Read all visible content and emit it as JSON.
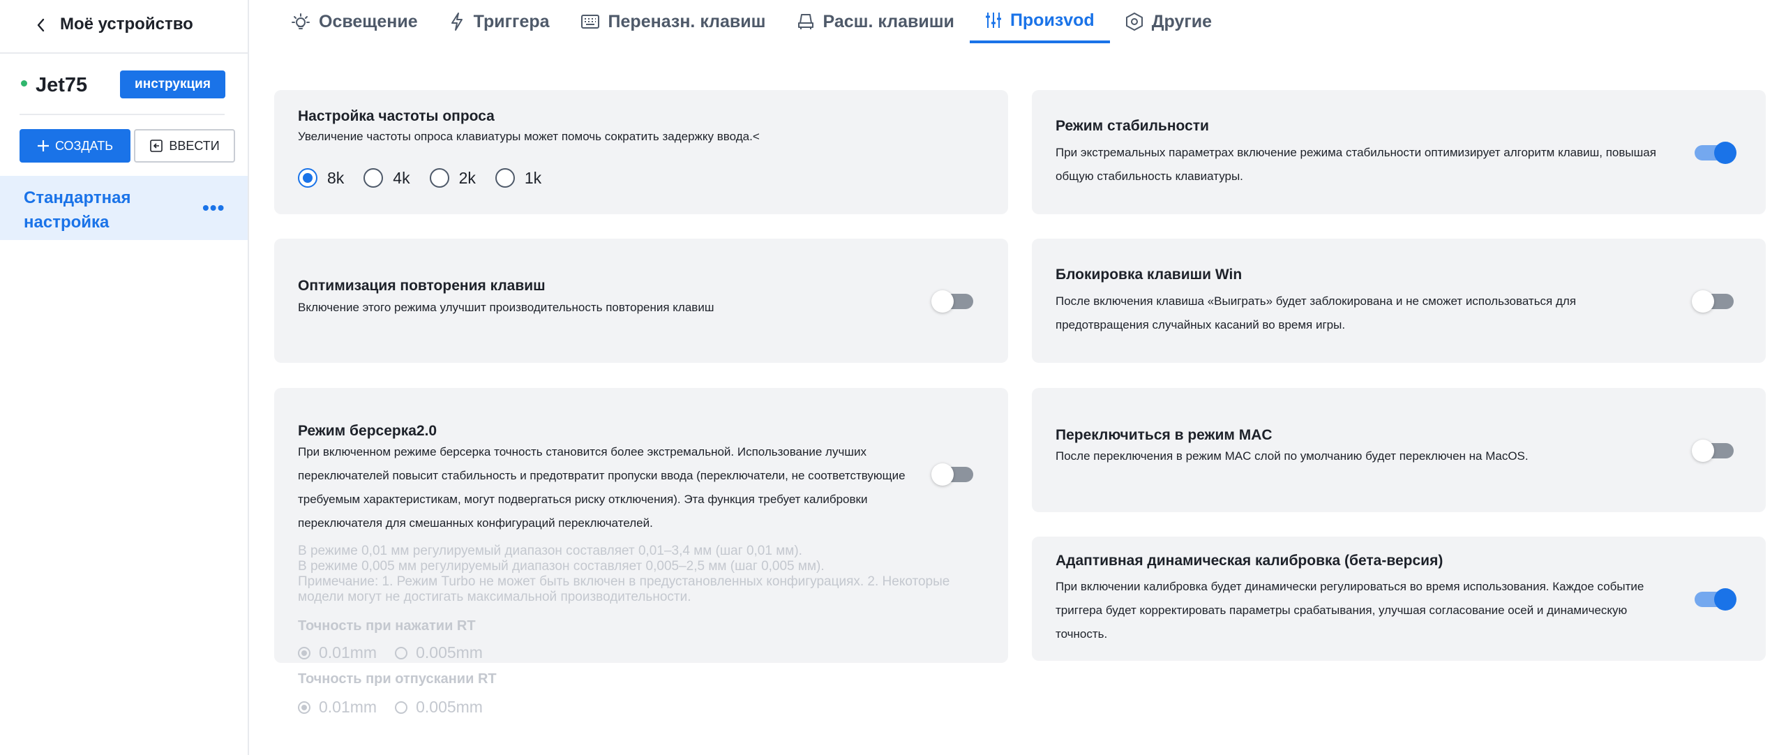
{
  "sidebar": {
    "title": "Моё устройство",
    "device_name": "Jet75",
    "instruction_button": "инструкция",
    "create_button": "СОЗДАТЬ",
    "import_button": "ВВЕСТИ",
    "profile": {
      "name": "Стандартная настройка",
      "more": "•••"
    }
  },
  "tabs": [
    {
      "label": "Освещение",
      "icon": "bulb-icon",
      "active": false
    },
    {
      "label": "Триггера",
      "icon": "lightning-icon",
      "active": false
    },
    {
      "label": "Переназн. клавиш",
      "icon": "keyboard-icon",
      "active": false
    },
    {
      "label": "Расш. клавиши",
      "icon": "seat-icon",
      "active": false
    },
    {
      "label": "Произvod",
      "icon": "sliders-icon",
      "active": true
    },
    {
      "label": "Другие",
      "icon": "hexagon-settings-icon",
      "active": false
    }
  ],
  "cards": {
    "polling": {
      "title": "Настройка частоты опроса",
      "desc": "Увеличение частоты опроса клавиатуры может помочь сократить задержку ввода.<",
      "options": [
        "8k",
        "4k",
        "2k",
        "1k"
      ],
      "selected": "8k"
    },
    "repeat": {
      "title": "Оптимизация повторения клавиш",
      "desc": "Включение этого режима улучшит производительность повторения клавиш",
      "enabled": false
    },
    "berserk": {
      "title": "Режим берсерка2.0",
      "desc_lines": [
        "При включенном режиме берсерка точность становится более экстремальной. Использование лучших",
        "переключателей повысит стабильность и предотвратит пропуски ввода (переключатели, не соответствующие",
        "требуемым характеристикам, могут подвергаться риску отключения). Эта функция требует калибровки",
        "переключателя для смешанных конфигураций переключателей."
      ],
      "note_lines": [
        "В режиме 0,01 мм регулируемый диапазон составляет 0,01–3,4 мм (шаг 0,01 мм).",
        "В режиме 0,005 мм регулируемый диапазон составляет 0,005–2,5 мм (шаг 0,005 мм).",
        "Примечание: 1. Режим Turbo не может быть включен в предустановленных конфигурациях. 2. Некоторые",
        "модели могут не достигать максимальной производительности."
      ],
      "press_label": "Точность при нажатии RT",
      "release_label": "Точность при отпускании RT",
      "precision_options": [
        "0.01mm",
        "0.005mm"
      ],
      "press_selected": "0.01mm",
      "release_selected": "0.01mm",
      "enabled": false
    },
    "stability": {
      "title": "Режим стабильности",
      "desc_lines": [
        "При экстремальных параметрах включение режима стабильности оптимизирует алгоритм клавиш, повышая",
        "общую стабильность клавиатуры."
      ],
      "enabled": true
    },
    "winlock": {
      "title": "Блокировка клавиши Win",
      "desc_lines": [
        "После включения клавиша «Выиграть» будет заблокирована и не сможет использоваться для",
        "предотвращения случайных касаний во время игры."
      ],
      "enabled": false
    },
    "mac": {
      "title": "Переключиться в режим MAC",
      "desc": "После переключения в режим MAC слой по умолчанию будет переключен на MacOS.",
      "enabled": false
    },
    "adaptive": {
      "title": "Адаптивная динамическая калибровка (бета-версия)",
      "desc_lines": [
        "При включении калибровка будет динамически регулироваться во время использования. Каждое событие",
        "триггера будет корректировать параметры срабатывания, улучшая согласование осей и динамическую",
        "точность."
      ],
      "enabled": true
    }
  },
  "colors": {
    "accent": "#1a73e8",
    "card_bg": "#f2f3f5",
    "active_profile_bg": "#e6f0fd",
    "status_dot": "#2fb66d"
  }
}
